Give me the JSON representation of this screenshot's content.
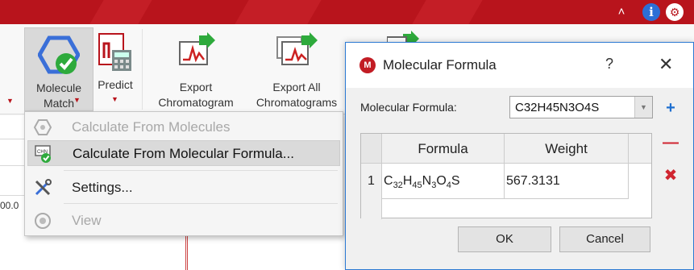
{
  "titlebar": {
    "color": "#b8141c",
    "controls": [
      {
        "icon": "minimize-icon",
        "glyph": "˄"
      },
      {
        "icon": "info-icon",
        "glyph": "i"
      },
      {
        "icon": "settings-icon",
        "glyph": "⚙"
      }
    ]
  },
  "ribbon": {
    "buttons": [
      {
        "label": "Molecule\nMatch",
        "icon": "molecule-match-icon",
        "has_caret": true,
        "active": true
      },
      {
        "label": "Predict",
        "icon": "predict-calculator-icon",
        "has_caret": true,
        "active": false
      },
      {
        "label": "Export\nChromatogram",
        "icon": "export-chromatogram-icon",
        "has_caret": false,
        "active": false
      },
      {
        "label": "Export All\nChromatograms",
        "icon": "export-all-chromatograms-icon",
        "has_caret": false,
        "active": false
      }
    ]
  },
  "background": {
    "axis_value": "00.0"
  },
  "menu": {
    "items": [
      {
        "label": "Calculate From Molecules",
        "icon": "molecules-icon",
        "enabled": false,
        "highlighted": false
      },
      {
        "label": "Calculate From Molecular Formula...",
        "icon": "chn-formula-icon",
        "enabled": true,
        "highlighted": true
      },
      {
        "label": "Settings...",
        "icon": "settings-tools-icon",
        "enabled": true,
        "highlighted": false
      },
      {
        "label": "View",
        "icon": "view-icon",
        "enabled": false,
        "highlighted": false
      }
    ]
  },
  "dialog": {
    "title": "Molecular Formula",
    "help_glyph": "?",
    "close_glyph": "✕",
    "formula_label": "Molecular Formula:",
    "formula_value": "C32H45N3O4S",
    "table": {
      "columns": [
        "Formula",
        "Weight"
      ],
      "rows": [
        {
          "index": "1",
          "formula_parts": [
            [
              "C",
              ""
            ],
            [
              "32",
              "sub"
            ],
            [
              "H",
              ""
            ],
            [
              "45",
              "sub"
            ],
            [
              "N",
              ""
            ],
            [
              "3",
              "sub"
            ],
            [
              "O",
              ""
            ],
            [
              "4",
              "sub"
            ],
            [
              "S",
              ""
            ]
          ],
          "weight": "567.3131"
        }
      ]
    },
    "side_buttons": [
      {
        "icon": "add-icon",
        "glyph": "+",
        "color": "#1e6fd0"
      },
      {
        "icon": "remove-icon",
        "glyph": "—",
        "color": "#d02530"
      },
      {
        "icon": "delete-all-icon",
        "glyph": "✖",
        "color": "#d02530"
      }
    ],
    "ok_label": "OK",
    "cancel_label": "Cancel"
  }
}
